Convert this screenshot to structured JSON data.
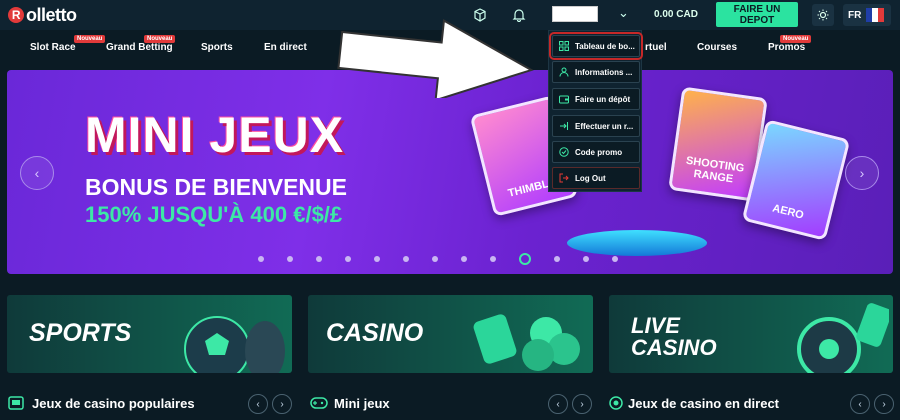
{
  "header": {
    "logo_text": "olletto",
    "logo_mark": "R",
    "account_value": "",
    "balance_amount": "0.00",
    "balance_currency": "CAD",
    "deposit_label": "FAIRE UN DEPOT",
    "language": "FR",
    "icons": [
      "box-icon",
      "bell-icon",
      "chevron-down-icon",
      "sun-icon",
      "france-flag-icon"
    ]
  },
  "nav": {
    "items": [
      {
        "label": "Slot Race",
        "badge": "Nouveau"
      },
      {
        "label": "Grand Betting",
        "badge": "Nouveau"
      },
      {
        "label": "Sports",
        "badge": ""
      },
      {
        "label": "En direct",
        "badge": ""
      },
      {
        "label": "rtuel",
        "badge": ""
      },
      {
        "label": "Courses",
        "badge": ""
      },
      {
        "label": "Promos",
        "badge": "Nouveau"
      }
    ]
  },
  "dropdown": {
    "items": [
      {
        "label": "Tableau de bo...",
        "icon": "dashboard-grid-icon"
      },
      {
        "label": "Informations ...",
        "icon": "user-icon"
      },
      {
        "label": "Faire un dépôt",
        "icon": "wallet-icon"
      },
      {
        "label": "Effectuer un r...",
        "icon": "withdraw-icon"
      },
      {
        "label": "Code promo",
        "icon": "promo-code-icon"
      },
      {
        "label": "Log Out",
        "icon": "logout-icon"
      }
    ]
  },
  "hero": {
    "line1": "MINI JEUX",
    "line2": "BONUS DE BIENVENUE",
    "line3": "150% JUSQU'À 400 €/$/£",
    "cards": [
      "THIMBLE",
      "SHOOTING RANGE",
      "AERO"
    ],
    "slides_total": 14,
    "active_slide": 10
  },
  "tiles": [
    "SPORTS",
    "CASINO",
    "LIVE CASINO"
  ],
  "sections": [
    {
      "title": "Jeux de casino populaires",
      "icon": "slot-machine-icon"
    },
    {
      "title": "Mini jeux",
      "icon": "gamepad-icon"
    },
    {
      "title": "Jeux de casino en direct",
      "icon": "live-chip-icon"
    }
  ],
  "colors": {
    "accent": "#2be3a0",
    "highlight": "#c62828",
    "hero": "#7f2fe8"
  }
}
